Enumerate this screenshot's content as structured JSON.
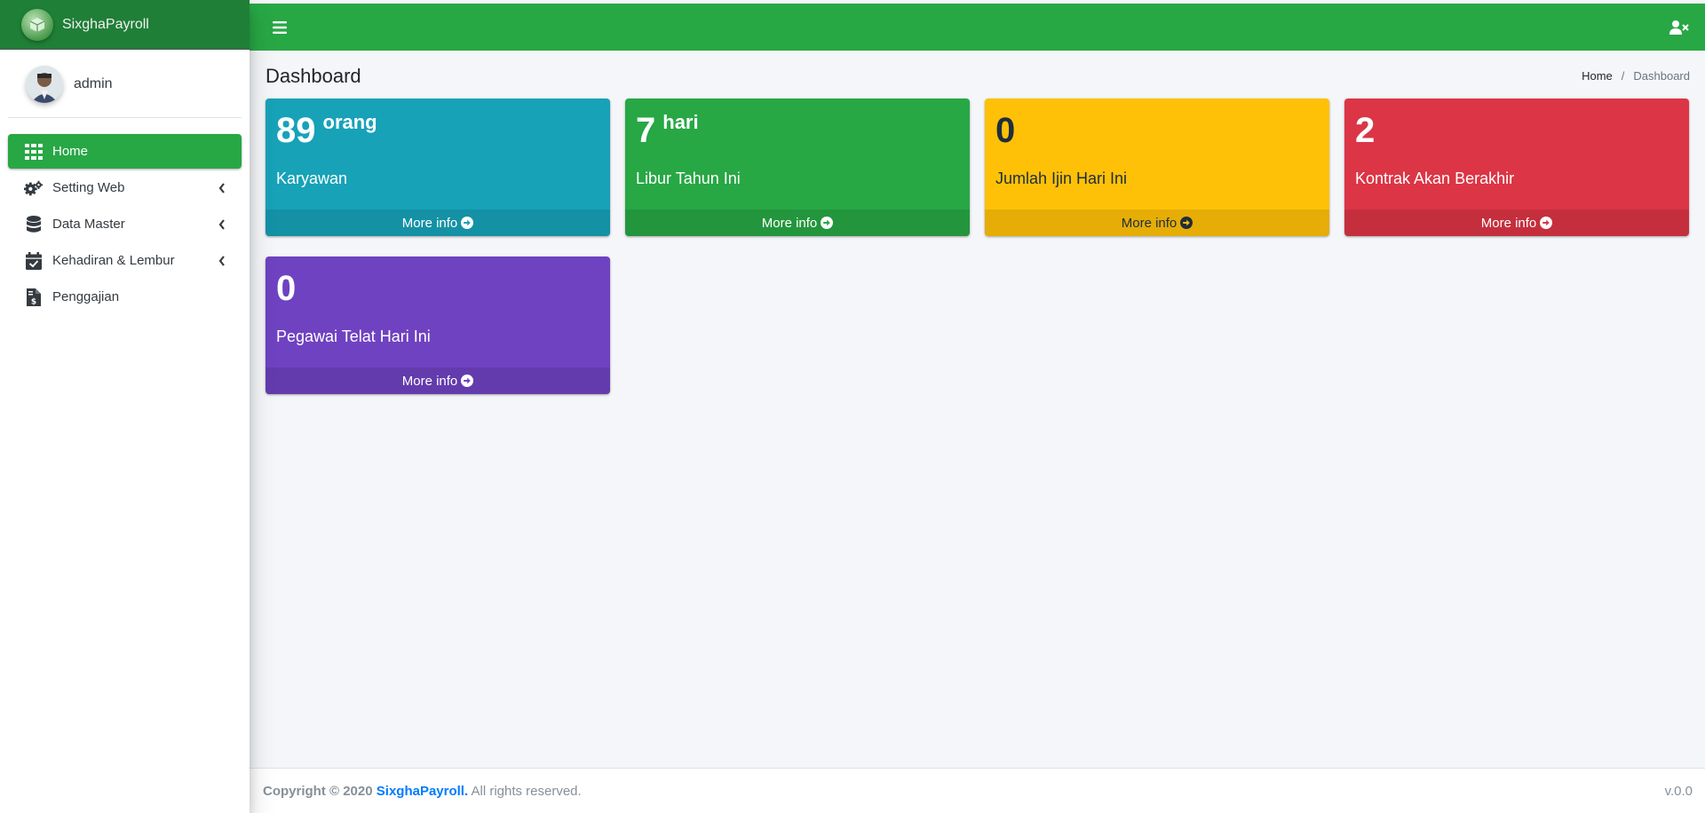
{
  "brand": {
    "name": "SixghaPayroll"
  },
  "user": {
    "name": "admin"
  },
  "sidebar": {
    "items": [
      {
        "label": "Home",
        "icon": "grid-icon",
        "active": true
      },
      {
        "label": "Setting Web",
        "icon": "gears-icon",
        "caret": true
      },
      {
        "label": "Data Master",
        "icon": "database-icon",
        "caret": true
      },
      {
        "label": "Kehadiran & Lembur",
        "icon": "calendar-check-icon",
        "caret": true
      },
      {
        "label": "Penggajian",
        "icon": "invoice-dollar-icon"
      }
    ]
  },
  "topbar": {
    "menu_icon": "bars-icon",
    "user_icon": "user-times-icon"
  },
  "header": {
    "title": "Dashboard",
    "breadcrumb": {
      "home": "Home",
      "separator": "/",
      "current": "Dashboard"
    }
  },
  "boxes": [
    {
      "value": "89",
      "unit": "orang",
      "label": "Karyawan",
      "more": "More info",
      "color": "#17a2b8"
    },
    {
      "value": "7",
      "unit": "hari",
      "label": "Libur Tahun Ini",
      "more": "More info",
      "color": "#28a745"
    },
    {
      "value": "0",
      "unit": "",
      "label": "Jumlah Ijin Hari Ini",
      "more": "More info",
      "color": "#ffc107"
    },
    {
      "value": "2",
      "unit": "",
      "label": "Kontrak Akan Berakhir",
      "more": "More info",
      "color": "#dc3545"
    },
    {
      "value": "0",
      "unit": "",
      "label": "Pegawai Telat Hari Ini",
      "more": "More info",
      "color": "#6f42c1"
    }
  ],
  "footer": {
    "copyright_prefix": "Copyright © 2020",
    "brand_link": "SixghaPayroll.",
    "rights": "All rights reserved.",
    "version": "v.0.0"
  },
  "colors": {
    "accent": "#28a745",
    "brand_bg": "#1f7f36",
    "link": "#007bff"
  }
}
